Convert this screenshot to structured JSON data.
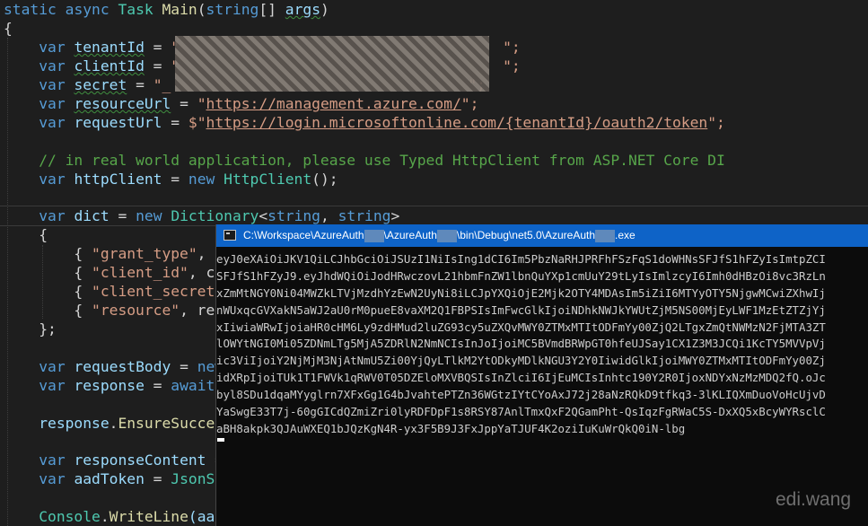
{
  "code": {
    "line_main": {
      "k1": "static",
      "k2": "async",
      "type": "Task",
      "fn": "Main",
      "p1": "(",
      "k3": "string",
      "p2": "[] ",
      "arg": "args",
      "p3": ")"
    },
    "brace_open": "{",
    "v_tenant": {
      "kw": "var",
      "name": "tenantId",
      "eq": " = ",
      "q1": "\"",
      "q2": "\";"
    },
    "v_client": {
      "kw": "var",
      "name": "clientId",
      "eq": " = ",
      "q1": "\"",
      "q2": "\";"
    },
    "v_secret": {
      "kw": "var",
      "name": "secret",
      "eq": " = ",
      "q1": "\"_",
      "q2": "\";"
    },
    "v_resource": {
      "kw": "var",
      "name": "resourceUrl",
      "eq": " = ",
      "q1": "\"",
      "url": "https://management.azure.com/",
      "q2": "\";"
    },
    "v_request": {
      "kw": "var",
      "name": "requestUrl",
      "eq": " = ",
      "q1": "$\"",
      "url": "https://login.microsoftonline.com/{tenantId}/oauth2/token",
      "q2": "\";"
    },
    "comment": "// in real world application, please use Typed HttpClient from ASP.NET Core DI",
    "v_http": {
      "kw": "var",
      "name": "httpClient",
      "eq": " = ",
      "new": "new",
      "type": "HttpClient",
      "tail": "();"
    },
    "v_dict": {
      "kw": "var",
      "name": "dict",
      "eq": " = ",
      "new": "new",
      "type": "Dictionary",
      "lt": "<",
      "t1": "string",
      "comma": ", ",
      "t2": "string",
      "gt": ">"
    },
    "brace_open2": "{",
    "kv1": {
      "lead": "{ ",
      "key": "\"grant_type\"",
      "rest": ", "
    },
    "kv2": {
      "lead": "{ ",
      "key": "\"client_id\"",
      "rest": ", c"
    },
    "kv3": {
      "lead": "{ ",
      "key": "\"client_secret"
    },
    "kv4": {
      "lead": "{ ",
      "key": "\"resource\"",
      "rest": ", re"
    },
    "brace_close": "};",
    "v_body": {
      "kw": "var",
      "name": "requestBody",
      "eq": " = ",
      "tail": "new"
    },
    "v_response": {
      "kw": "var",
      "name": "response",
      "eq": " = ",
      "tail": "await"
    },
    "ensure": {
      "obj": "response",
      "dot": ".",
      "fn": "EnsureSuccess"
    },
    "v_content": {
      "kw": "var",
      "name": "responseContent",
      "eq": " ="
    },
    "v_token": {
      "kw": "var",
      "name": "aadToken",
      "eq": " = ",
      "tail": "JsonSe"
    },
    "console_line": {
      "obj": "Console",
      "dot": ".",
      "fn": "WriteLine",
      "tail": "(aad"
    }
  },
  "console_window": {
    "title_a": "C:\\Workspace\\AzureAuth",
    "title_b": "\\AzureAuth",
    "title_c": "\\bin\\Debug\\net5.0\\AzureAuth",
    "title_d": ".exe",
    "output": [
      "eyJ0eXAiOiJKV1QiLCJhbGciOiJSUzI1NiIsIng1dCI6Im5PbzNaRHJPRFhFSzFqS1doWHNsSFJfS1hFZyIsImtpZCI",
      "SFJfS1hFZyJ9.eyJhdWQiOiJodHRwczovL21hbmFnZW1lbnQuYXp1cmUuY29tLyIsImlzcyI6Imh0dHBzOi8vc3RzLn",
      "xZmMtNGY0Ni04MWZkLTVjMzdhYzEwN2UyNi8iLCJpYXQiOjE2Mjk2OTY4MDAsIm5iZiI6MTYyOTY5NjgwMCwiZXhwIj",
      "nWUxqcGVXakN5aWJ2aU0rM0pueE8vaXM2Q1FBPSIsImFwcGlkIjoiNDhkNWJkYWUtZjM5NS00MjEyLWF1MzEtZTZjYj",
      "xIiwiaWRwIjoiaHR0cHM6Ly9zdHMud2luZG93cy5uZXQvMWY0ZTMxMTItODFmYy00ZjQ2LTgxZmQtNWMzN2FjMTA3ZT",
      "lOWYtNGI0Mi05ZDNmLTg5MjA5ZDRlN2NmNCIsInJoIjoiMC5BVmdBRWpGT0hfeUJSay1CX1Z3M3JCQi1KcTY5MVVpVj",
      "ic3ViIjoiY2NjMjM3NjAtNmU5Zi00YjQyLTlkM2YtODkyMDlkNGU3Y2Y0IiwidGlkIjoiMWY0ZTMxMTItODFmYy00Zj",
      "idXRpIjoiTUk1T1FWVk1qRWV0T05DZEloMXVBQSIsInZlciI6IjEuMCIsInhtc190Y2R0IjoxNDYxNzMzMDQ2fQ.oJc",
      "byl8SDu1dqaMYyglrn7XFxGg1G4bJvahtePTZn36WGtzIYtCYoAxJ72j28aNzRQkD9tfkq3-3lKLIQXmDuoVoHcUjvD",
      "YaSwgE33T7j-60gGICdQZmiZri0lyRDFDpF1s8RSY87AnlTmxQxF2QGamPht-QsIqzFgRWaC5S-DxXQ5xBcyWYRsclC",
      "aBH8akpk3QJAuWXEQ1bJQzKgN4R-yx3F5B9J3FxJppYaTJUF4K2oziIuKuWrQkQ0iN-lbg"
    ]
  },
  "watermark": "edi.wang"
}
